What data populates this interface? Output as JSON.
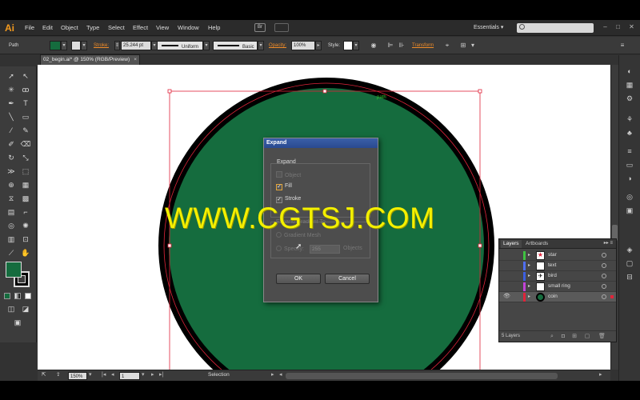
{
  "app": {
    "logo": "Ai",
    "menu": [
      "File",
      "Edit",
      "Object",
      "Type",
      "Select",
      "Effect",
      "View",
      "Window",
      "Help"
    ],
    "bridge_label": "Br",
    "workspace": "Essentials",
    "workspace_arrow": "▾"
  },
  "control_bar": {
    "selection_type": "Path",
    "stroke_label": "Stroke:",
    "stroke_weight": "25.244 pt",
    "profile_label": "Uniform",
    "brush_label": "Basic",
    "opacity_label": "Opacity:",
    "opacity_value": "100%",
    "style_label": "Style:",
    "transform_label": "Transform"
  },
  "document": {
    "tab_title": "02_begin.ai* @ 150% (RGB/Preview)",
    "close": "×",
    "path_hint": "path"
  },
  "status_bar": {
    "zoom": "150%",
    "artboard_num": "1",
    "tool_name": "Selection"
  },
  "expand_dialog": {
    "title": "Expand",
    "group_label": "Expand",
    "object_label": "Object",
    "fill_label": "Fill",
    "stroke_label": "Stroke",
    "expand_gradient_label": "Expand Gradient To",
    "gradient_mesh_label": "Gradient Mesh",
    "specify_label": "Specify:",
    "specify_value": "255",
    "objects_label": "Objects",
    "ok_label": "OK",
    "cancel_label": "Cancel",
    "fill_checked": true,
    "stroke_checked": true,
    "object_checked": false
  },
  "watermark": "WWW.CGTSJ.COM",
  "layers_panel": {
    "tab_layers": "Layers",
    "tab_artboards": "Artboards",
    "layer_count": "5 Layers",
    "layers": [
      {
        "name": "star",
        "color": "#3fc241"
      },
      {
        "name": "text",
        "color": "#4f6ff0"
      },
      {
        "name": "bird",
        "color": "#3c5fe0"
      },
      {
        "name": "small ring",
        "color": "#c242d8"
      },
      {
        "name": "coin",
        "color": "#e0243a"
      }
    ]
  },
  "colors": {
    "accent": "#f08c28",
    "coin_fill": "#156c3e",
    "coin_stroke": "#000000",
    "selection": "#e0243a",
    "watermark": "#f4f000"
  }
}
